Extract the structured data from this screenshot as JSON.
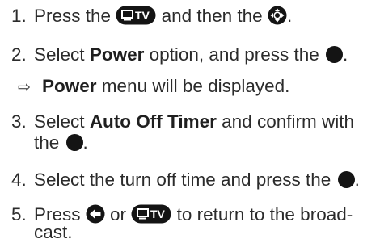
{
  "steps": [
    {
      "num": "1.",
      "t1": "Press the",
      "t2": "and then the",
      "t3": "."
    },
    {
      "num": "2.",
      "t1": "Select",
      "bold": "Power",
      "t2": "option, and press the",
      "t3": "."
    },
    {
      "bold": "Power",
      "t2": "menu will be displayed."
    },
    {
      "num": "3.",
      "t1": "Select",
      "bold": "Auto Off Timer",
      "t2": "and confirm with",
      "line2_a": "the",
      "line2_b": "."
    },
    {
      "num": "4.",
      "t1": "Select the turn off time and press the",
      "t3": "."
    },
    {
      "num": "5.",
      "t1": "Press",
      "t2": "or",
      "t3": "to return to the broad-",
      "line2_a": "cast."
    }
  ],
  "icons": {
    "tv_button_text": "TV",
    "tv_button": "tv-button-icon",
    "nav_pad": "nav-pad-icon",
    "ok_dot": "ok-dot-icon",
    "back": "back-arrow-icon"
  }
}
